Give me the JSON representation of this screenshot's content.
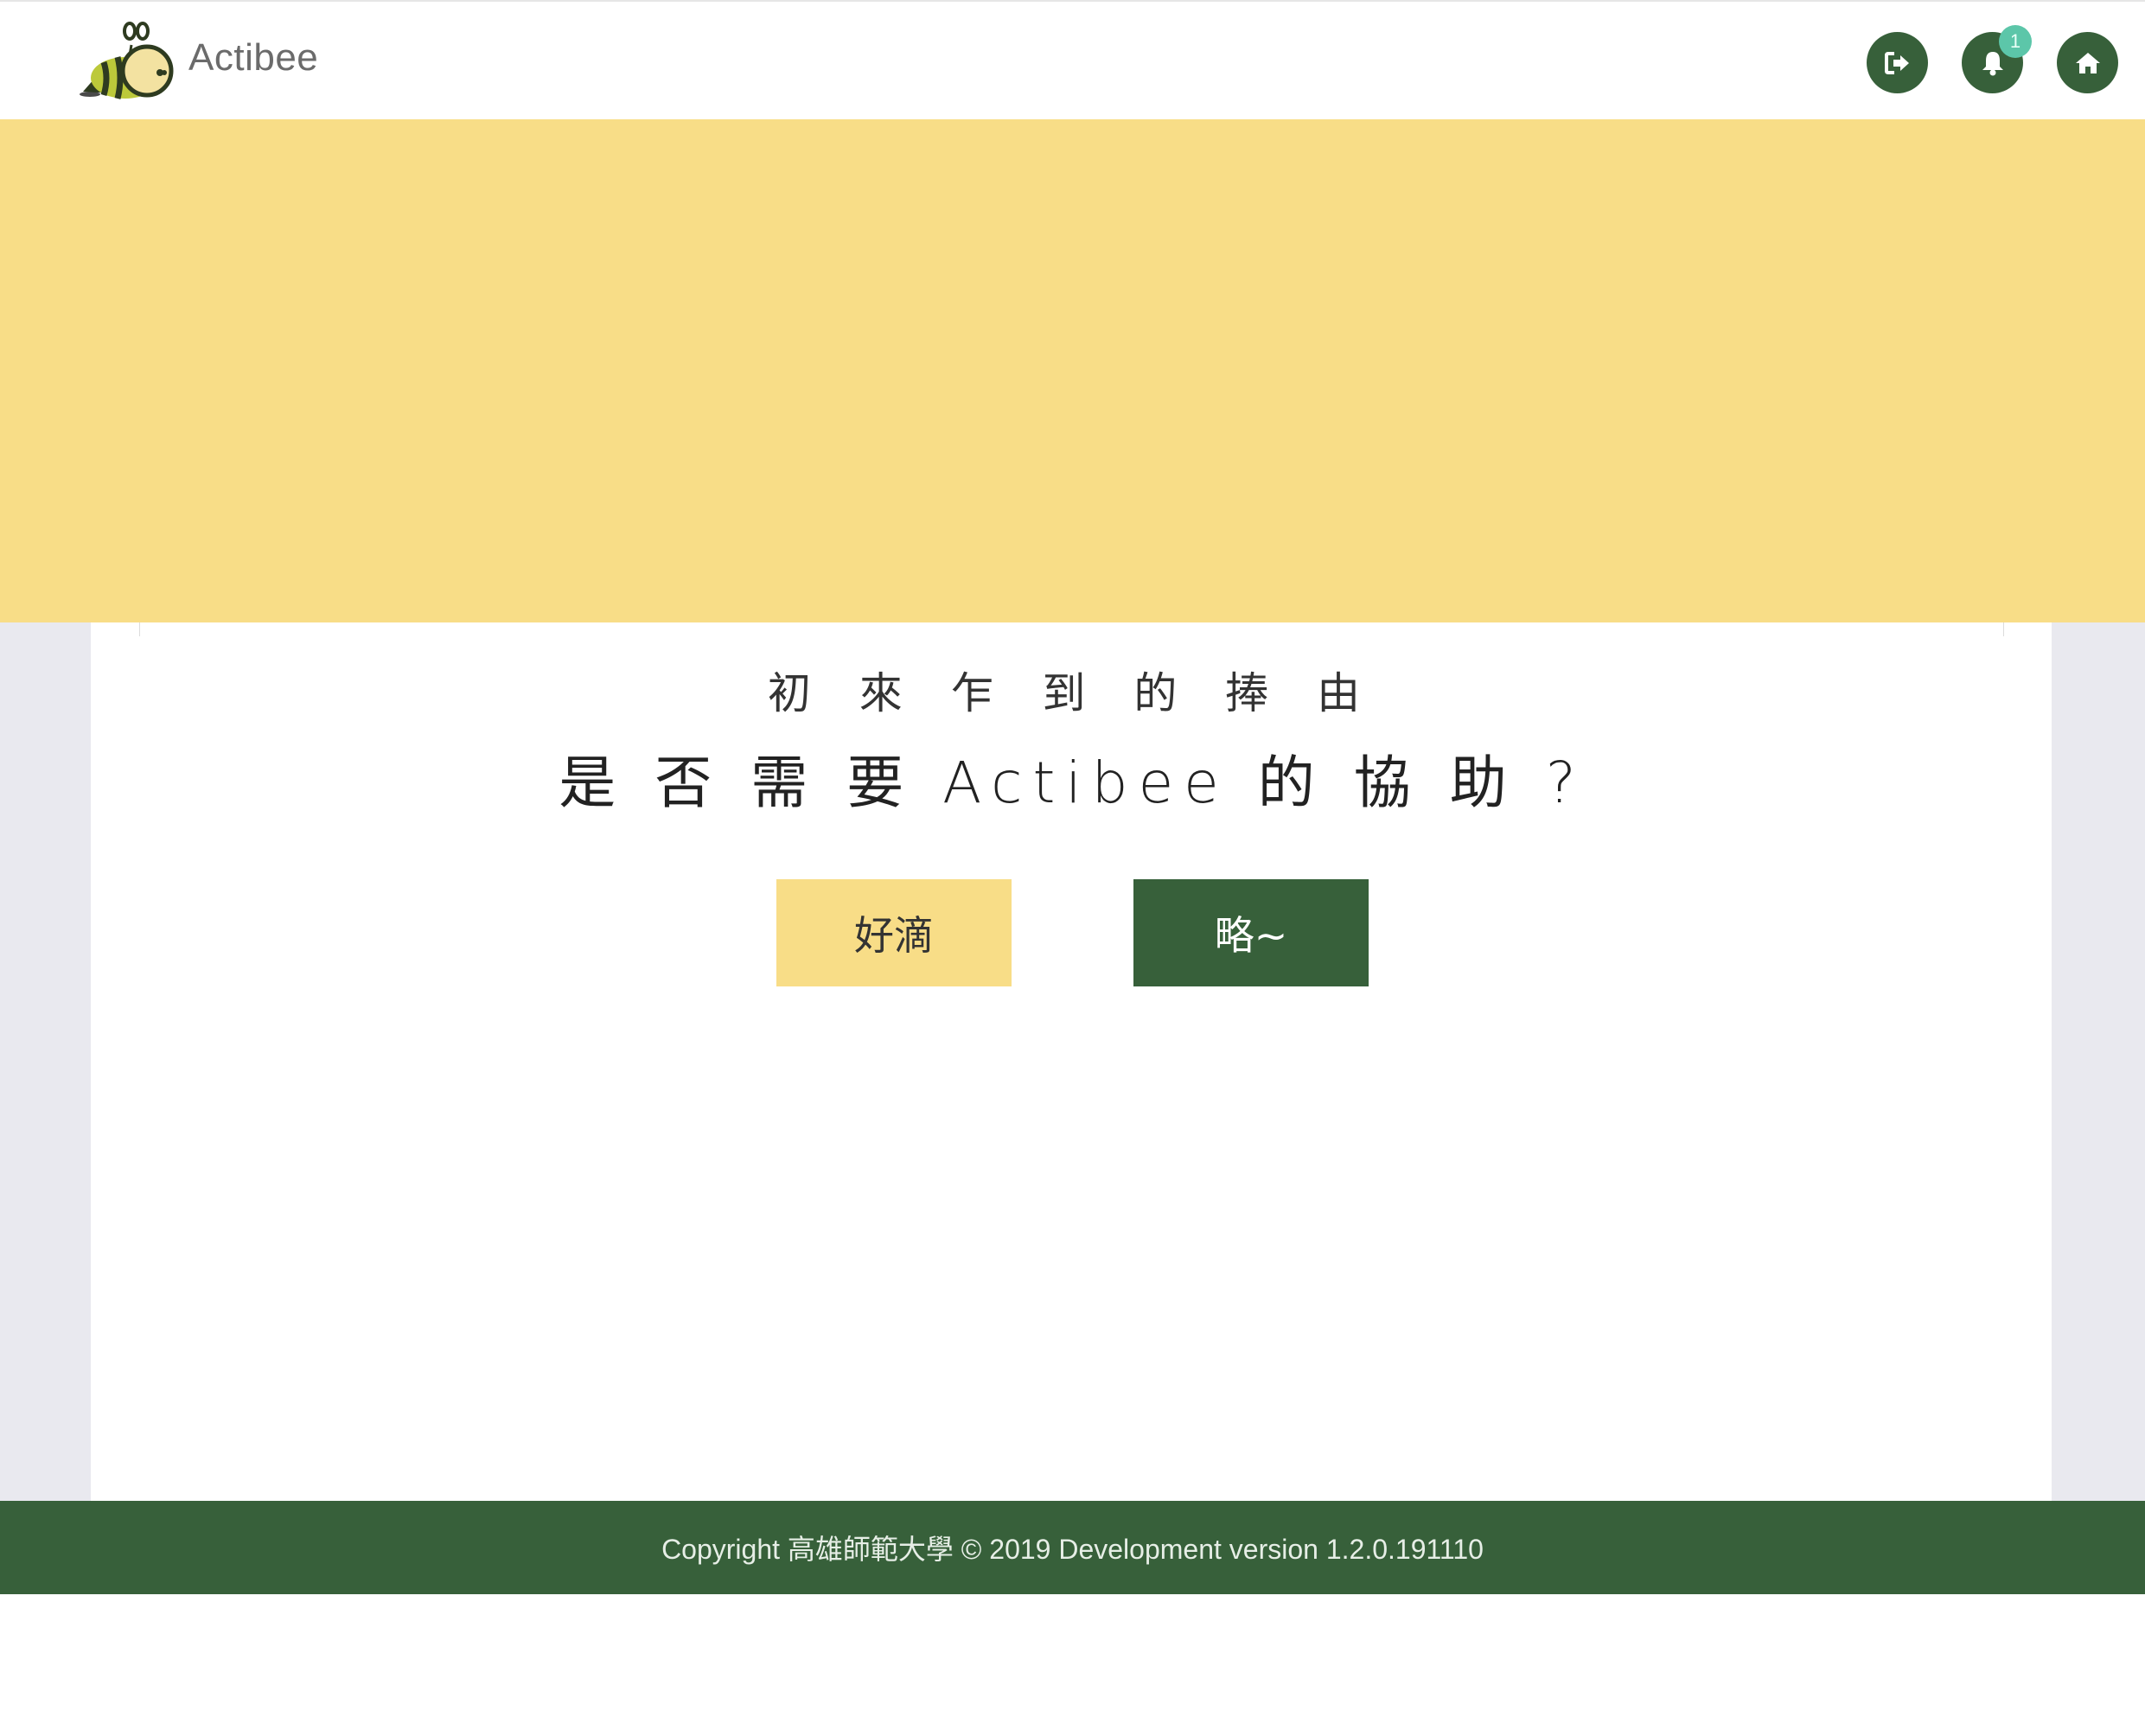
{
  "header": {
    "brand": "Actibee",
    "notification_count": "1",
    "icons": [
      "logout-icon",
      "bell-icon",
      "home-icon"
    ]
  },
  "prompt": {
    "subtitle": "初 來 乍 到 的 捧 由",
    "question": "是 否 需 要 Actibee 的 協 助 ?",
    "yes_label": "好滴",
    "no_label": "略~"
  },
  "footer": {
    "text": "Copyright 高雄師範大學 © 2019 Development version 1.2.0.191110"
  },
  "colors": {
    "primary_green": "#37603a",
    "hero_yellow": "#f8dd87",
    "badge_teal": "#5cc6a9",
    "content_bg": "#e9e9ef"
  }
}
